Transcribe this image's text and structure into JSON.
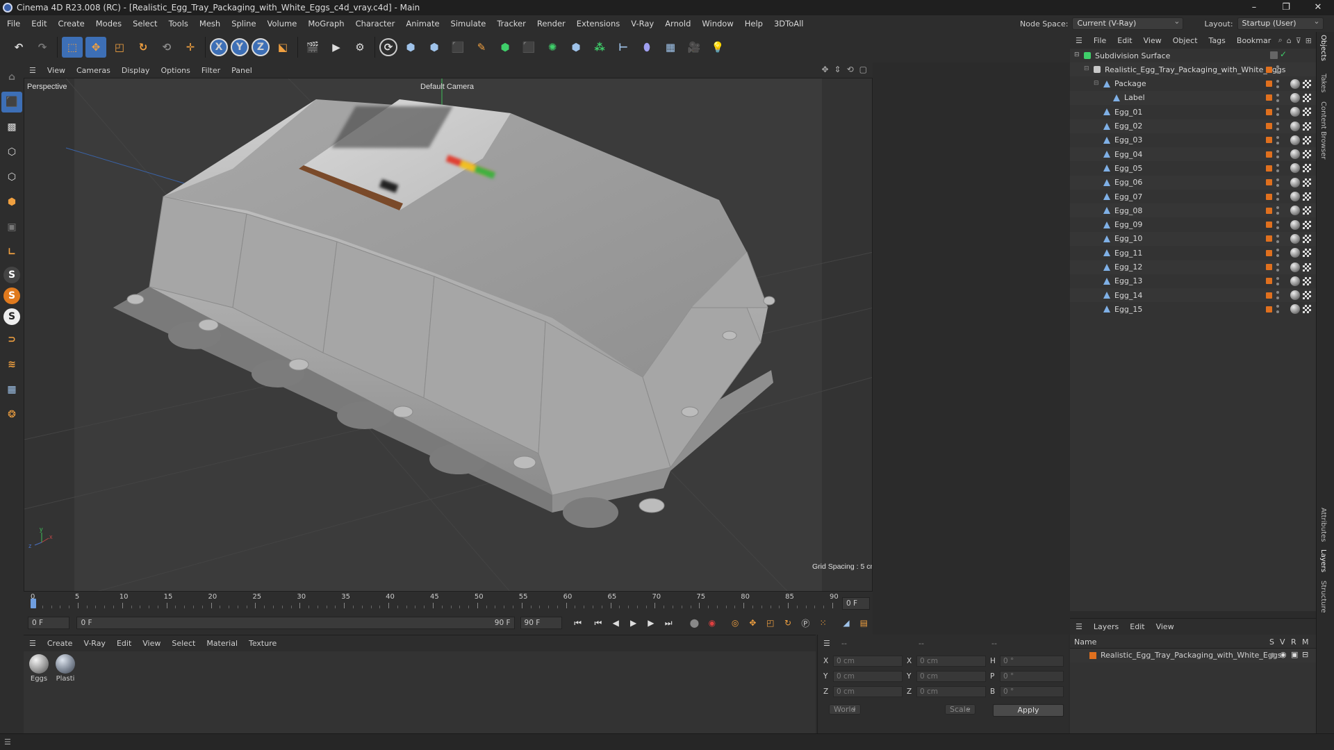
{
  "window": {
    "title": "Cinema 4D R23.008 (RC) - [Realistic_Egg_Tray_Packaging_with_White_Eggs_c4d_vray.c4d] - Main",
    "controls": [
      "–",
      "❐",
      "✕"
    ]
  },
  "menubar": {
    "items": [
      "File",
      "Edit",
      "Create",
      "Modes",
      "Select",
      "Tools",
      "Mesh",
      "Spline",
      "Volume",
      "MoGraph",
      "Character",
      "Animate",
      "Simulate",
      "Tracker",
      "Render",
      "Extensions",
      "V-Ray",
      "Arnold",
      "Window",
      "Help",
      "3DToAll"
    ],
    "node_space_label": "Node Space:",
    "node_space_value": "Current (V-Ray)",
    "layout_label": "Layout:",
    "layout_value": "Startup (User)"
  },
  "toolbar": {
    "axis_x": "X",
    "axis_y": "Y",
    "axis_z": "Z"
  },
  "lefttools": {
    "s1": "S",
    "s2": "S",
    "s3": "S"
  },
  "viewport": {
    "menu": [
      "View",
      "Cameras",
      "Display",
      "Options",
      "Filter",
      "Panel"
    ],
    "label": "Perspective",
    "camera": "Default Camera",
    "grid_spacing": "Grid Spacing : 5 cm",
    "axis_x": "x",
    "axis_y": "y",
    "axis_z": "z"
  },
  "timeline": {
    "ticks": [
      "0",
      "5",
      "10",
      "15",
      "20",
      "25",
      "30",
      "35",
      "40",
      "45",
      "50",
      "55",
      "60",
      "65",
      "70",
      "75",
      "80",
      "85",
      "90"
    ],
    "current_frame_field": "0 F",
    "start_field": "0 F",
    "range_start": "0 F",
    "range_end": "90 F",
    "end_field": "90 F"
  },
  "material_manager": {
    "menu": [
      "Create",
      "V-Ray",
      "Edit",
      "View",
      "Select",
      "Material",
      "Texture"
    ],
    "materials": [
      "Eggs",
      "Plasti"
    ]
  },
  "coordinates": {
    "header": [
      "--",
      "--",
      "--"
    ],
    "rows": [
      {
        "a": "X",
        "av": "0 cm",
        "b": "X",
        "bv": "0 cm",
        "c": "H",
        "cv": "0 °"
      },
      {
        "a": "Y",
        "av": "0 cm",
        "b": "Y",
        "bv": "0 cm",
        "c": "P",
        "cv": "0 °"
      },
      {
        "a": "Z",
        "av": "0 cm",
        "b": "Z",
        "bv": "0 cm",
        "c": "B",
        "cv": "0 °"
      }
    ],
    "mode": "World",
    "scale": "Scale",
    "apply": "Apply"
  },
  "object_manager": {
    "menu": [
      "File",
      "Edit",
      "View",
      "Object",
      "Tags",
      "Bookmar"
    ],
    "objects": [
      {
        "name": "Subdivision Surface",
        "indent": 0
      },
      {
        "name": "Realistic_Egg_Tray_Packaging_with_White_Eggs",
        "indent": 1
      },
      {
        "name": "Package",
        "indent": 2
      },
      {
        "name": "Label",
        "indent": 3
      },
      {
        "name": "Egg_01",
        "indent": 2
      },
      {
        "name": "Egg_02",
        "indent": 2
      },
      {
        "name": "Egg_03",
        "indent": 2
      },
      {
        "name": "Egg_04",
        "indent": 2
      },
      {
        "name": "Egg_05",
        "indent": 2
      },
      {
        "name": "Egg_06",
        "indent": 2
      },
      {
        "name": "Egg_07",
        "indent": 2
      },
      {
        "name": "Egg_08",
        "indent": 2
      },
      {
        "name": "Egg_09",
        "indent": 2
      },
      {
        "name": "Egg_10",
        "indent": 2
      },
      {
        "name": "Egg_11",
        "indent": 2
      },
      {
        "name": "Egg_12",
        "indent": 2
      },
      {
        "name": "Egg_13",
        "indent": 2
      },
      {
        "name": "Egg_14",
        "indent": 2
      },
      {
        "name": "Egg_15",
        "indent": 2
      }
    ]
  },
  "layers": {
    "menu": [
      "Layers",
      "Edit",
      "View"
    ],
    "columns": {
      "name": "Name",
      "s": "S",
      "v": "V",
      "r": "R",
      "m": "M"
    },
    "rows": [
      {
        "name": "Realistic_Egg_Tray_Packaging_with_White_Eggs",
        "color": "#e0701e"
      }
    ]
  },
  "right_tabs": [
    "Objects",
    "Takes",
    "Content Browser",
    "Attributes",
    "Layers",
    "Structure"
  ],
  "colors": {
    "accent": "#e0701e",
    "selection": "#3d6fb6"
  }
}
